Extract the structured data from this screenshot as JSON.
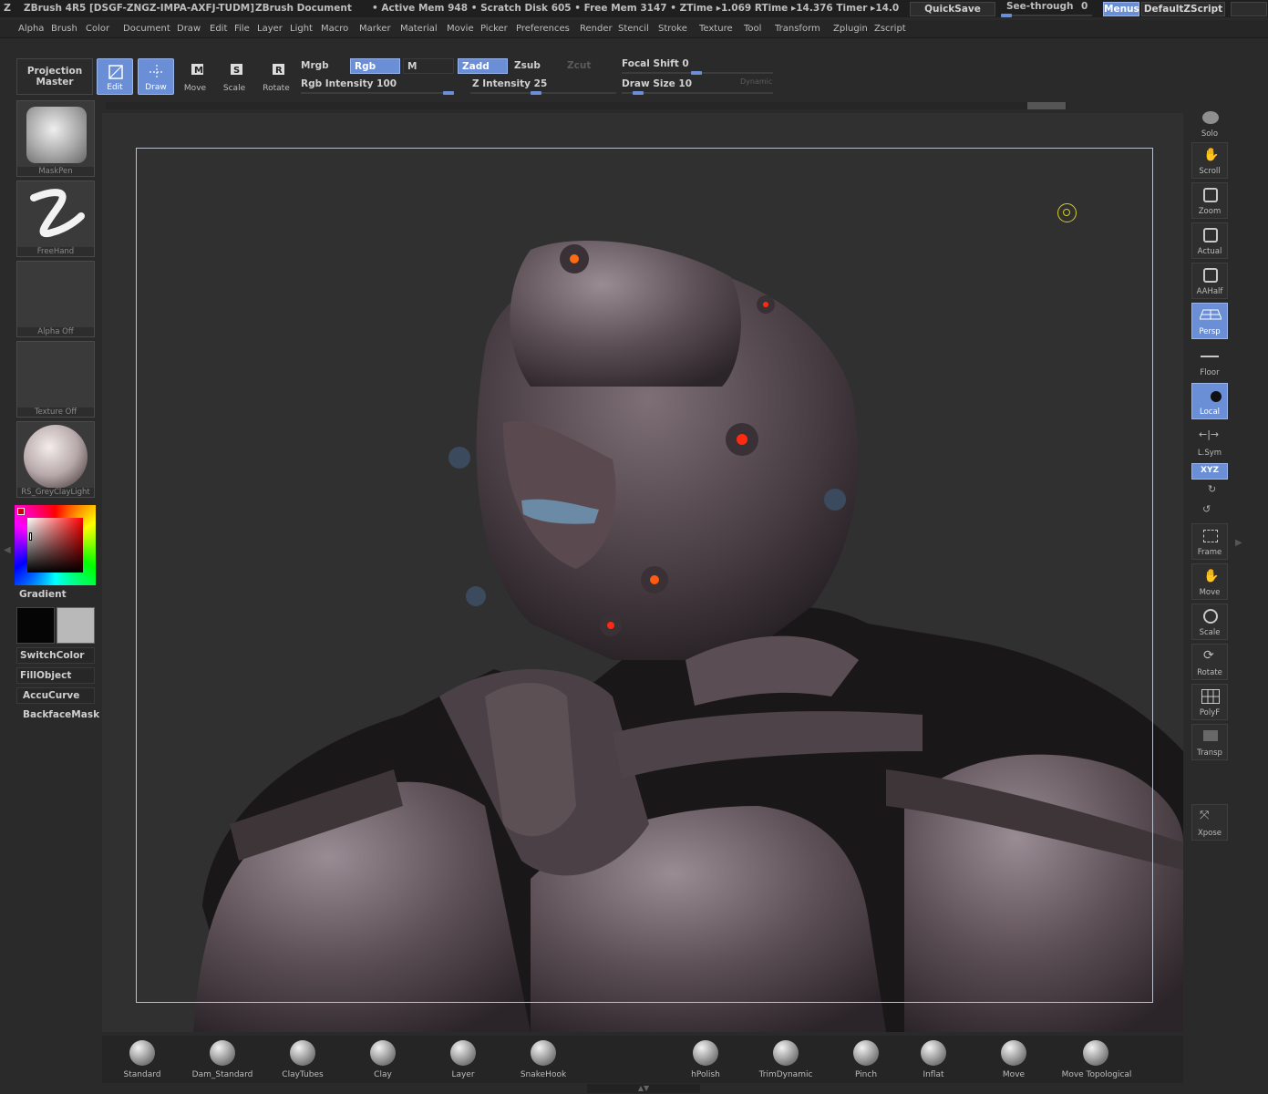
{
  "titlebar": {
    "app": "ZBrush 4R5 [DSGF-ZNGZ-IMPA-AXFJ-TUDM]",
    "doc": "ZBrush Document",
    "stats": "• Active Mem 948 • Scratch Disk 605 • Free Mem 3147 • ZTime ▸1.069 RTime ▸14.376 Timer ▸14.0",
    "quicksave": "QuickSave",
    "seethrough": "See-through",
    "seethrough_val": "0",
    "menus": "Menus",
    "script": "DefaultZScript"
  },
  "menubar": [
    "Alpha",
    "Brush",
    "Color",
    "Document",
    "Draw",
    "Edit",
    "File",
    "Layer",
    "Light",
    "Macro",
    "Marker",
    "Material",
    "Movie",
    "Picker",
    "Preferences",
    "Render",
    "Stencil",
    "Stroke",
    "Texture",
    "Tool",
    "Transform",
    "Zplugin",
    "Zscript"
  ],
  "toolbar": {
    "projection": "Projection Master",
    "edit": "Edit",
    "draw": "Draw",
    "move": "Move",
    "scale": "Scale",
    "rotate": "Rotate",
    "mrgb": "Mrgb",
    "rgb": "Rgb",
    "m": "M",
    "zadd": "Zadd",
    "zsub": "Zsub",
    "zcut": "Zcut",
    "rgb_intensity": "Rgb Intensity 100",
    "rgb_intensity_value": 1.0,
    "z_intensity": "Z Intensity 25",
    "z_intensity_value": 0.25,
    "focal_shift": "Focal Shift 0",
    "focal_shift_value": 0.0,
    "draw_size": "Draw Size 10",
    "draw_size_value": 0.1,
    "dynamic": "Dynamic"
  },
  "leftpanel": {
    "brush": "MaskPen",
    "stroke": "FreeHand",
    "alpha": "Alpha Off",
    "texture": "Texture Off",
    "material": "RS_GreyClayLight",
    "gradient": "Gradient",
    "switchcolor": "SwitchColor",
    "fillobject": "FillObject",
    "accucurve": "AccuCurve",
    "backfacemask": "BackfaceMask"
  },
  "rightpanel": [
    "Solo",
    "Scroll",
    "Zoom",
    "Actual",
    "AAHalf",
    "Persp",
    "Floor",
    "Local",
    "L.Sym",
    "XYZ",
    "Frame",
    "Move",
    "Scale",
    "Rotate",
    "PolyF",
    "Transp",
    "Xpose"
  ],
  "brushes": [
    "Standard",
    "Dam_Standard",
    "ClayTubes",
    "Clay",
    "Layer",
    "SnakeHook",
    "hPolish",
    "TrimDynamic",
    "Pinch",
    "Inflat",
    "Move",
    "Move Topological"
  ],
  "colors": {
    "accent": "#6a8fd6",
    "bg": "#2a2a2a",
    "canvas": "#303030"
  }
}
